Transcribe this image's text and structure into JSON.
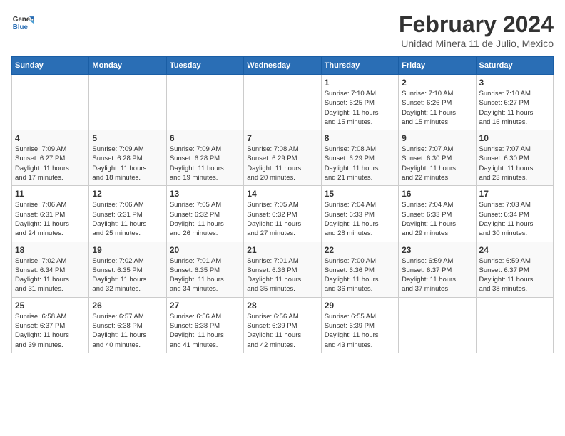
{
  "logo": {
    "line1": "General",
    "line2": "Blue"
  },
  "title": "February 2024",
  "subtitle": "Unidad Minera 11 de Julio, Mexico",
  "days_header": [
    "Sunday",
    "Monday",
    "Tuesday",
    "Wednesday",
    "Thursday",
    "Friday",
    "Saturday"
  ],
  "weeks": [
    [
      {
        "day": "",
        "info": ""
      },
      {
        "day": "",
        "info": ""
      },
      {
        "day": "",
        "info": ""
      },
      {
        "day": "",
        "info": ""
      },
      {
        "day": "1",
        "info": "Sunrise: 7:10 AM\nSunset: 6:25 PM\nDaylight: 11 hours\nand 15 minutes."
      },
      {
        "day": "2",
        "info": "Sunrise: 7:10 AM\nSunset: 6:26 PM\nDaylight: 11 hours\nand 15 minutes."
      },
      {
        "day": "3",
        "info": "Sunrise: 7:10 AM\nSunset: 6:27 PM\nDaylight: 11 hours\nand 16 minutes."
      }
    ],
    [
      {
        "day": "4",
        "info": "Sunrise: 7:09 AM\nSunset: 6:27 PM\nDaylight: 11 hours\nand 17 minutes."
      },
      {
        "day": "5",
        "info": "Sunrise: 7:09 AM\nSunset: 6:28 PM\nDaylight: 11 hours\nand 18 minutes."
      },
      {
        "day": "6",
        "info": "Sunrise: 7:09 AM\nSunset: 6:28 PM\nDaylight: 11 hours\nand 19 minutes."
      },
      {
        "day": "7",
        "info": "Sunrise: 7:08 AM\nSunset: 6:29 PM\nDaylight: 11 hours\nand 20 minutes."
      },
      {
        "day": "8",
        "info": "Sunrise: 7:08 AM\nSunset: 6:29 PM\nDaylight: 11 hours\nand 21 minutes."
      },
      {
        "day": "9",
        "info": "Sunrise: 7:07 AM\nSunset: 6:30 PM\nDaylight: 11 hours\nand 22 minutes."
      },
      {
        "day": "10",
        "info": "Sunrise: 7:07 AM\nSunset: 6:30 PM\nDaylight: 11 hours\nand 23 minutes."
      }
    ],
    [
      {
        "day": "11",
        "info": "Sunrise: 7:06 AM\nSunset: 6:31 PM\nDaylight: 11 hours\nand 24 minutes."
      },
      {
        "day": "12",
        "info": "Sunrise: 7:06 AM\nSunset: 6:31 PM\nDaylight: 11 hours\nand 25 minutes."
      },
      {
        "day": "13",
        "info": "Sunrise: 7:05 AM\nSunset: 6:32 PM\nDaylight: 11 hours\nand 26 minutes."
      },
      {
        "day": "14",
        "info": "Sunrise: 7:05 AM\nSunset: 6:32 PM\nDaylight: 11 hours\nand 27 minutes."
      },
      {
        "day": "15",
        "info": "Sunrise: 7:04 AM\nSunset: 6:33 PM\nDaylight: 11 hours\nand 28 minutes."
      },
      {
        "day": "16",
        "info": "Sunrise: 7:04 AM\nSunset: 6:33 PM\nDaylight: 11 hours\nand 29 minutes."
      },
      {
        "day": "17",
        "info": "Sunrise: 7:03 AM\nSunset: 6:34 PM\nDaylight: 11 hours\nand 30 minutes."
      }
    ],
    [
      {
        "day": "18",
        "info": "Sunrise: 7:02 AM\nSunset: 6:34 PM\nDaylight: 11 hours\nand 31 minutes."
      },
      {
        "day": "19",
        "info": "Sunrise: 7:02 AM\nSunset: 6:35 PM\nDaylight: 11 hours\nand 32 minutes."
      },
      {
        "day": "20",
        "info": "Sunrise: 7:01 AM\nSunset: 6:35 PM\nDaylight: 11 hours\nand 34 minutes."
      },
      {
        "day": "21",
        "info": "Sunrise: 7:01 AM\nSunset: 6:36 PM\nDaylight: 11 hours\nand 35 minutes."
      },
      {
        "day": "22",
        "info": "Sunrise: 7:00 AM\nSunset: 6:36 PM\nDaylight: 11 hours\nand 36 minutes."
      },
      {
        "day": "23",
        "info": "Sunrise: 6:59 AM\nSunset: 6:37 PM\nDaylight: 11 hours\nand 37 minutes."
      },
      {
        "day": "24",
        "info": "Sunrise: 6:59 AM\nSunset: 6:37 PM\nDaylight: 11 hours\nand 38 minutes."
      }
    ],
    [
      {
        "day": "25",
        "info": "Sunrise: 6:58 AM\nSunset: 6:37 PM\nDaylight: 11 hours\nand 39 minutes."
      },
      {
        "day": "26",
        "info": "Sunrise: 6:57 AM\nSunset: 6:38 PM\nDaylight: 11 hours\nand 40 minutes."
      },
      {
        "day": "27",
        "info": "Sunrise: 6:56 AM\nSunset: 6:38 PM\nDaylight: 11 hours\nand 41 minutes."
      },
      {
        "day": "28",
        "info": "Sunrise: 6:56 AM\nSunset: 6:39 PM\nDaylight: 11 hours\nand 42 minutes."
      },
      {
        "day": "29",
        "info": "Sunrise: 6:55 AM\nSunset: 6:39 PM\nDaylight: 11 hours\nand 43 minutes."
      },
      {
        "day": "",
        "info": ""
      },
      {
        "day": "",
        "info": ""
      }
    ]
  ]
}
